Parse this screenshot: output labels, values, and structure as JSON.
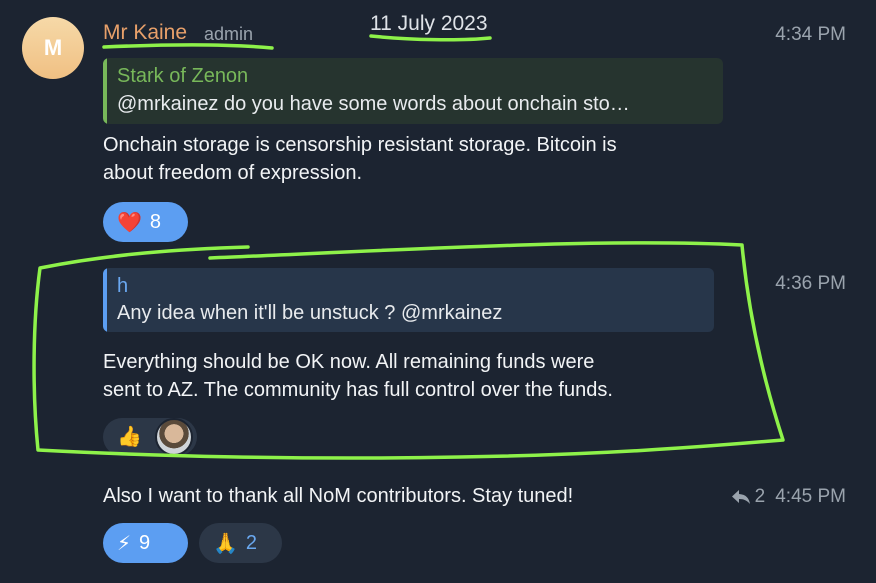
{
  "header": {
    "avatar_initial": "M",
    "sender": "Mr Kaine",
    "role": "admin",
    "date": "11 July 2023"
  },
  "messages": [
    {
      "time": "4:34 PM",
      "reply_to": {
        "name": "Stark of Zenon",
        "text": "@mrkainez do you have some words about onchain sto…",
        "accent": "#78b85a"
      },
      "lines": [
        "Onchain storage is censorship resistant storage. Bitcoin is",
        "about freedom of expression."
      ],
      "reactions": [
        {
          "emoji": "❤️",
          "count": "8",
          "active": true
        }
      ]
    },
    {
      "time": "4:36 PM",
      "reply_to": {
        "name": "h",
        "text": "Any idea when it'll be unstuck ? @mrkainez",
        "accent": "#5c9ef2"
      },
      "lines": [
        "Everything should be OK now. All remaining funds were",
        "sent to AZ. The community has full control over the funds."
      ],
      "reactions": [
        {
          "emoji": "👍",
          "count": "",
          "active": false
        }
      ]
    },
    {
      "time": "4:45 PM",
      "reply_count": "2",
      "lines": [
        "Also I want to thank all NoM contributors. Stay tuned!"
      ],
      "reactions": [
        {
          "emoji": "⚡",
          "count": "9",
          "active": true
        },
        {
          "emoji": "🙏",
          "count": "2",
          "active": false
        }
      ]
    }
  ],
  "colors": {
    "background": "#1c2431",
    "highlight": "#8ef24a",
    "reply_green": "#78b85a",
    "reply_blue": "#5c9ef2"
  }
}
